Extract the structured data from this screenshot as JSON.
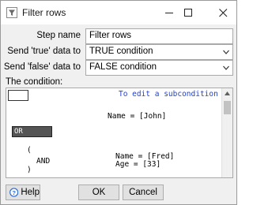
{
  "window": {
    "title": "Filter rows"
  },
  "form": {
    "step_name_label": "Step name",
    "step_name_value": "Filter rows",
    "true_label": "Send 'true' data to",
    "true_value": "TRUE condition",
    "false_label": "Send 'false' data to",
    "false_value": "FALSE condition"
  },
  "condition": {
    "label": "The condition:",
    "edit_link": "To edit a subcondition",
    "line1": "Name = [John]",
    "operator": "OR",
    "open_paren": "(",
    "and_op": "AND",
    "close_paren": ")",
    "sub_line1": "Name = [Fred]",
    "sub_line2": "Age = [33]"
  },
  "buttons": {
    "help": "Help",
    "ok": "OK",
    "cancel": "Cancel"
  },
  "icons": {
    "app": "filter-rows-icon",
    "minimize": "minimize-icon",
    "maximize": "maximize-icon",
    "close": "close-icon",
    "help": "help-icon",
    "edit": "edit-subcondition-icon"
  }
}
